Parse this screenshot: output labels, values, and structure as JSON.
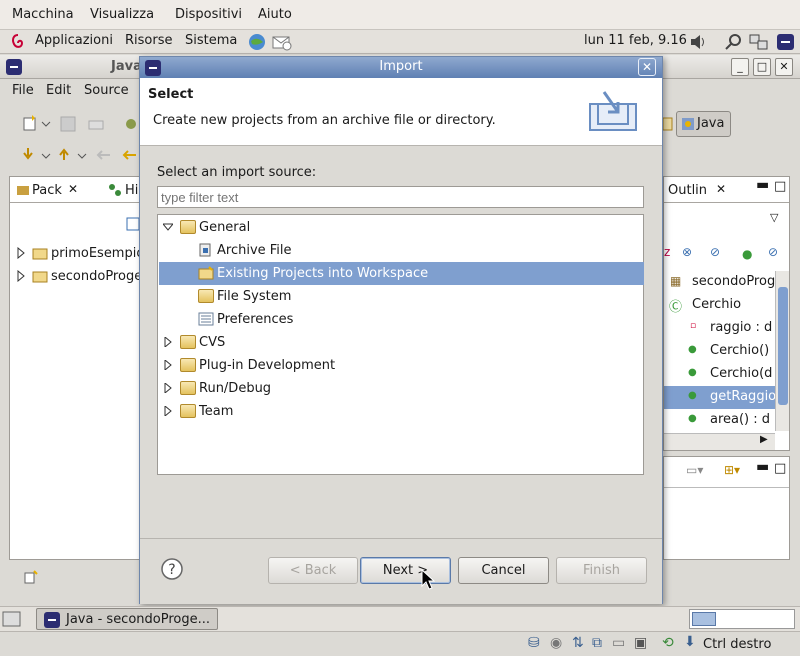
{
  "vm_menu": [
    "Macchina",
    "Visualizza",
    "Dispositivi",
    "Aiuto"
  ],
  "panel": {
    "menus": [
      "Applicazioni",
      "Risorse",
      "Sistema"
    ],
    "clock": "lun 11 feb,  9.16"
  },
  "eclipse": {
    "title_partial": "Java",
    "menu": [
      "File",
      "Edit",
      "Source"
    ],
    "perspective": "Java",
    "left_tabs": [
      "Pack",
      "Hi"
    ],
    "projects": [
      "primoEsempio",
      "secondoProge"
    ],
    "outline_tab": "Outlin",
    "outline_items": [
      "secondoProg",
      "Cerchio",
      "raggio : d",
      "Cerchio()",
      "Cerchio(d",
      "getRaggio",
      "area() : d"
    ]
  },
  "dialog": {
    "title": "Import",
    "header_title": "Select",
    "header_desc": "Create new projects from an archive file or directory.",
    "source_label": "Select an import source:",
    "filter_placeholder": "type filter text",
    "tree": [
      {
        "label": "General",
        "expanded": true,
        "level": 0
      },
      {
        "label": "Archive File",
        "level": 1
      },
      {
        "label": "Existing Projects into Workspace",
        "level": 1,
        "selected": true
      },
      {
        "label": "File System",
        "level": 1
      },
      {
        "label": "Preferences",
        "level": 1
      },
      {
        "label": "CVS",
        "level": 0
      },
      {
        "label": "Plug-in Development",
        "level": 0
      },
      {
        "label": "Run/Debug",
        "level": 0
      },
      {
        "label": "Team",
        "level": 0
      }
    ],
    "buttons": {
      "back": "< Back",
      "next": "Next >",
      "cancel": "Cancel",
      "finish": "Finish"
    }
  },
  "taskbar": {
    "task": "Java - secondoProge..."
  },
  "statusbar": {
    "host_key": "Ctrl destro"
  }
}
